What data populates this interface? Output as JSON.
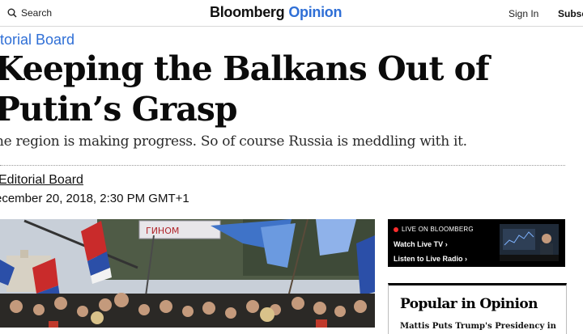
{
  "header": {
    "search_label": "Search",
    "logo_brand": "Bloomberg",
    "logo_section": "Opinion",
    "signin_label": "Sign In",
    "subscribe_label": "Subsc"
  },
  "article": {
    "kicker": "litorial Board",
    "headline": "Keeping the Balkans Out of Putin’s Grasp",
    "dek": "he region is making progress. So of course Russia is meddling with it.",
    "byline": "Editorial Board",
    "date": "ecember 20, 2018, 2:30 PM GMT+1",
    "photo_banner_text": "ГИНОМ"
  },
  "sidebar": {
    "live_label": "LIVE ON BLOOMBERG",
    "watch_label": "Watch Live TV",
    "listen_label": "Listen to Live Radio",
    "chevron": "›",
    "popular_title": "Popular in Opinion",
    "popular_first_item": "Mattis Puts Trump's Presidency in"
  },
  "colors": {
    "accent": "#2f6fd6",
    "live_dot": "#ff2d2d"
  },
  "icons": [
    "search-icon",
    "chevron-right-icon",
    "live-dot-icon"
  ]
}
